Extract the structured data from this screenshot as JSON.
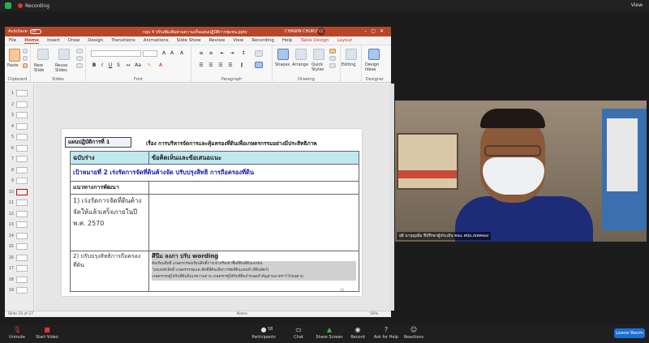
{
  "zoom_top": {
    "recording_label": "Recording",
    "view_label": "View"
  },
  "ppt": {
    "autosave_label": "AutoSave",
    "autosave_state": "Off",
    "filename": "กลุ่ม 4 ปรับเพิ่มเติมตามความเห็นแผนปฏิบัติการชุมชน.pptx",
    "username": "CHAWIN CHUKUSOL",
    "initials": "CC",
    "menu": [
      "File",
      "Home",
      "Insert",
      "Draw",
      "Design",
      "Transitions",
      "Animations",
      "Slide Show",
      "Review",
      "View",
      "Recording",
      "Help",
      "Table Design",
      "Layout"
    ],
    "ribbon": {
      "clipboard": "Clipboard",
      "paste": "Paste",
      "slides": "Slides",
      "new_slide": "New Slide",
      "reuse_slides": "Reuse Slides",
      "font": "Font",
      "paragraph": "Paragraph",
      "drawing": "Drawing",
      "shapes": "Shapes",
      "arrange": "Arrange",
      "quick_styles": "Quick Styles",
      "editing": "Editing",
      "designer": "Designer",
      "design_ideas": "Design Ideas"
    },
    "thumbs": [
      "1",
      "2",
      "3",
      "4",
      "5",
      "6",
      "7",
      "8",
      "9",
      "10",
      "11",
      "12",
      "13",
      "14",
      "15",
      "16",
      "17",
      "18",
      "19"
    ],
    "active_slide": "10",
    "slide": {
      "plan_label": "แผนปฏิบัติการที่ 1",
      "plan_title": "เรื่อง การบริหารจัดการและคุ้มครองที่ดินเพื่อเกษตรกรรมอย่างมีประสิทธิภาพ",
      "header_left": "ฉบับร่าง",
      "header_right": "ข้อคิดเห็นและข้อเสนอแนะ",
      "goal": "เป้าหมายที่ 2 เร่งรัดการจัดที่ดินค้างจัด ปรับปรุงสิทธิ การถือครองที่ดิน",
      "dev_label": "แนวทางการพัฒนา",
      "row1_left": "1) เร่งรัดการจัดที่ดินค้างจัดให้แล้วเสร็จภายในปี พ.ศ. 2570",
      "row2_left": "2) ปรับปรุงสิทธิการถือครองที่ดิน",
      "comment_bold": "ศึนึม ลงภา ปรับ wording",
      "comment_line1": "ข้อเรียนสิทธิ์ เกษตรกรขอเรียนสิทธิ์การเช่าหรือเช่าซื้อที่ดินที่ดินเอกชน",
      "comment_line2": "\"มอบหลักสิทธิ์ เกษตรกรขอและสิทธิ์ที่ดินเพื่อการจัดที่ดินแทนที่ (ที่ดินสัตว์)",
      "comment_line3": "เกษตรกรอยู่ได้รับที่ดินถึงแก่ความตาย เกษตรกรผู้ได้รับที่ดินกำหนดสำคัญตามมาตราไว้ก่อนตาย",
      "page_number": "10"
    },
    "status": {
      "slide_info": "Slide 10 of 27",
      "notes": "Notes",
      "zoom": "56%"
    }
  },
  "cam": {
    "name": "สุธี นาบุญเพิ่ม ที่ปรึกษาผู้ประเมิน คณะ ศปม.เขตคลอง"
  },
  "zoom_bottom": {
    "unmute": "Unmute",
    "start_video": "Start Video",
    "participants": "Participants",
    "participants_count": "58",
    "chat": "Chat",
    "share_screen": "Share Screen",
    "record": "Record",
    "ask_help": "Ask for Help",
    "reactions": "Reactions",
    "leave": "Leave Room"
  }
}
